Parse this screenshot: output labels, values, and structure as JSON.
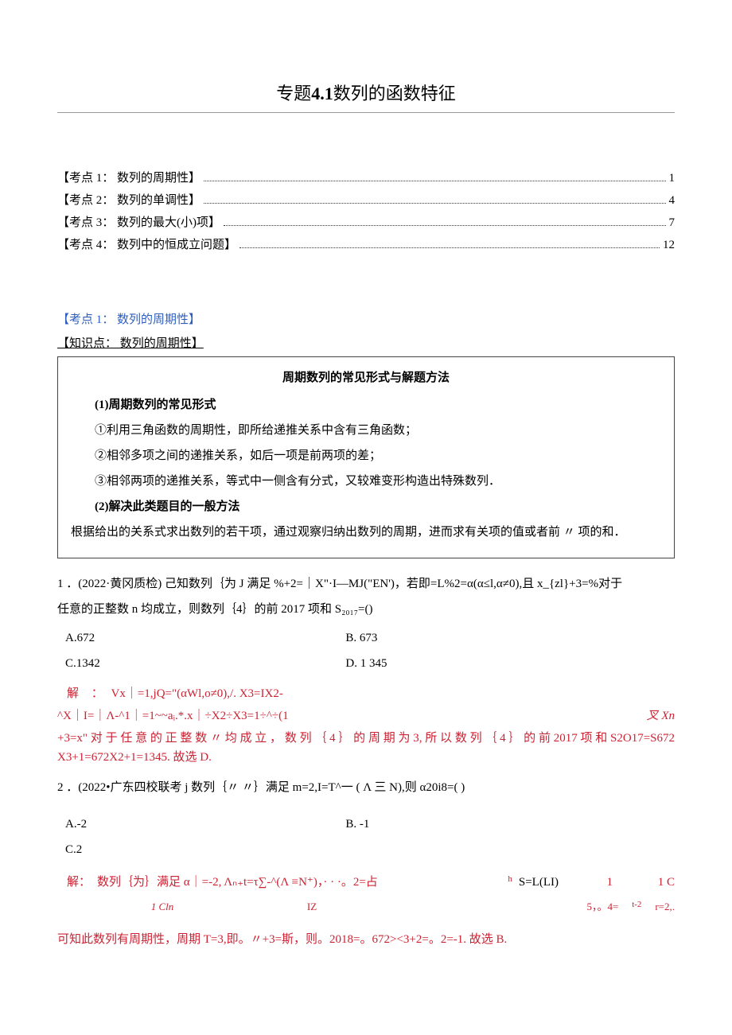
{
  "title": {
    "pre": "专题",
    "num": "4.1",
    "post": "数列的函数特征"
  },
  "toc": [
    {
      "label": "【考点 1： 数列的周期性】",
      "page": "1"
    },
    {
      "label": "【考点 2： 数列的单调性】",
      "page": "4"
    },
    {
      "label": "【考点 3： 数列的最大(小)项】",
      "page": "7"
    },
    {
      "label": "【考点 4： 数列中的恒成立问题】",
      "page": "12"
    }
  ],
  "section_heading_blue": "【考点 1： 数列的周期性】",
  "section_heading_black": "【知识点： 数列的周期性】",
  "box": {
    "title": "周期数列的常见形式与解题方法",
    "sub1": "(1)周期数列的常见形式",
    "l1": "①利用三角函数的周期性，即所给递推关系中含有三角函数；",
    "l2": "②相邻多项之间的递推关系，如后一项是前两项的差；",
    "l3": "③相邻两项的递推关系，等式中一侧含有分式，又较难变形构造出特殊数列．",
    "sub2": "(2)解决此类题目的一般方法",
    "l4": "根据给出的关系式求出数列的若干项，通过观察归纳出数列的周期，进而求有关项的值或者前 〃 项的和．"
  },
  "q1": {
    "text1": "1 ．(2022·黄冈质检) 己知数列｛为 J 满足 %+2=｜X\"·I—MJ(\"EN')，若即=L%2=α(α≤l,α≠0),且 x_{zl}+3=%对于",
    "text2": "任意的正整数 n 均成立，则数列｛4｝的前 2017 项和 S₂₀₁₇=()",
    "optA": "A.672",
    "optB": "B. 673",
    "optC": "C.1342",
    "optD": "D. 1 345",
    "sol_label": "解 ：",
    "sol_body1": "Vx｜=1,jQ=\"(αWl,o≠0),/. X3=IX2-",
    "sol_body2": "^X｜I=｜Λ-^1｜=1~~aᵢ.*.x｜÷X2÷X3=1÷^÷(1",
    "sol_body2_right": "叉 Xn",
    "sol_body3": "+3=x\" 对 于 任 意 的 正 整 数 〃 均 成 立 ， 数 列 ｛ 4 ｝ 的 周 期 为 3, 所 以 数 列 ｛ 4 ｝ 的 前 2017 项 和 S2O17=S672X3+1=672X2+1=1345. 故选 D."
  },
  "q2": {
    "text1": "2 ．(2022•广东四校联考 j 数列｛〃 〃｝满足 m=2,I=T^一 ( Λ 三 N),则 α20i8=(           )",
    "optA": "A.-2",
    "optB": "B. -1",
    "optC": "C.2",
    "optD_blank": "",
    "sol_label": "解：",
    "sol_line1_a": "数列｛为｝满足  α｜=-2, Λₙ₊t=τ∑-^(Λ ≡N⁺)，· · ·。2=占",
    "sol_line1_b": "h",
    "sol_line1_c": "S=L(LI)",
    "sol_line1_d": "1",
    "sol_line1_e": "1      C",
    "sol_line2_a": "1 Cln",
    "sol_line2_b": "IZ",
    "sol_line2_c": "5，。4=",
    "sol_line2_d": "r=2,.",
    "sol_line2_e": "t-2",
    "sol_final": "可知此数列有周期性，周期 T=3,即。〃+3=斯，则。2018=。672><3+2=。2=-1. 故选 B."
  }
}
